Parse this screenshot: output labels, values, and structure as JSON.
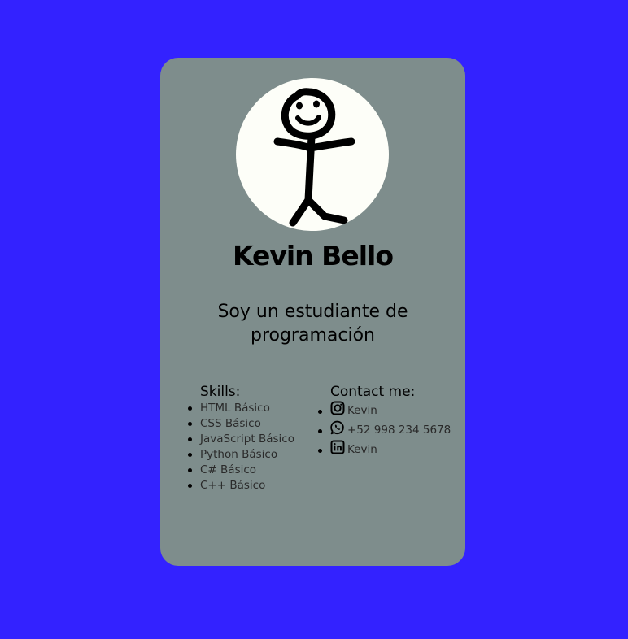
{
  "colors": {
    "page_background": "#3322ff",
    "card_background": "#7e8d8c",
    "avatar_background": "#fdfef8"
  },
  "profile": {
    "name": "Kevin Bello",
    "tagline": "Soy un estudiante de programación",
    "avatar_icon": "stick-figure-icon"
  },
  "skills": {
    "title": "Skills:",
    "items": [
      "HTML Básico",
      "CSS Básico",
      "JavaScript Básico",
      "Python Básico",
      "C# Básico",
      "C++ Básico"
    ]
  },
  "contact": {
    "title": "Contact me:",
    "items": [
      {
        "icon": "instagram-icon",
        "label": "Kevin"
      },
      {
        "icon": "whatsapp-icon",
        "label": "+52 998 234 5678"
      },
      {
        "icon": "linkedin-icon",
        "label": "Kevin"
      }
    ]
  }
}
